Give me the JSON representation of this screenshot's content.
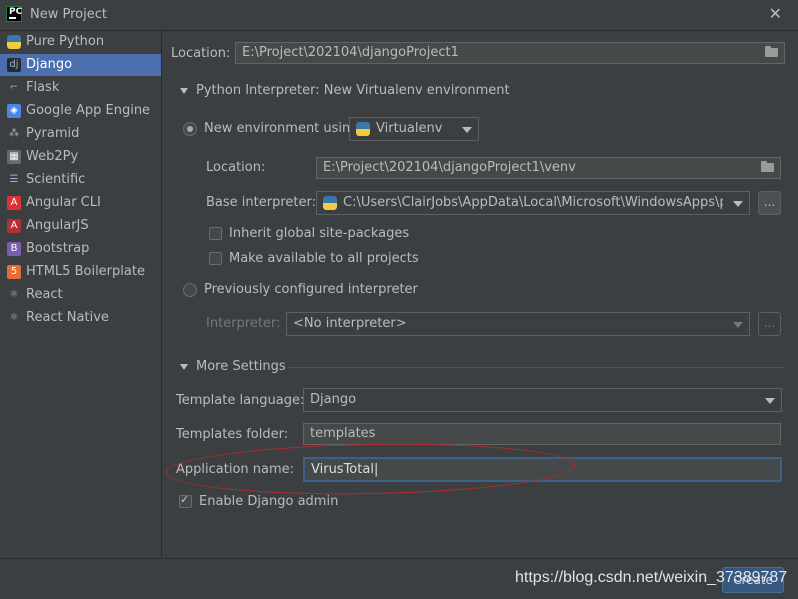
{
  "window": {
    "app_icon": "PC",
    "title": "New Project",
    "close_icon": "close-icon"
  },
  "sidebar": {
    "items": [
      {
        "label": "Pure Python",
        "icon": "python-icon",
        "icon_text": "",
        "color": "#3b77a8",
        "selected": false
      },
      {
        "label": "Django",
        "icon": "django-icon",
        "icon_text": "dj",
        "color": "#2b2b2b",
        "selected": true
      },
      {
        "label": "Flask",
        "icon": "flask-icon",
        "icon_text": "⌐",
        "color": "#3c3f41",
        "selected": false
      },
      {
        "label": "Google App Engine",
        "icon": "google-app-engine-icon",
        "icon_text": "◈",
        "color": "#4a86e8",
        "selected": false
      },
      {
        "label": "Pyramid",
        "icon": "pyramid-icon",
        "icon_text": "⁂",
        "color": "#3c3f41",
        "selected": false
      },
      {
        "label": "Web2Py",
        "icon": "web2py-icon",
        "icon_text": "▦",
        "color": "#6a6a6a",
        "selected": false
      },
      {
        "label": "Scientific",
        "icon": "scientific-icon",
        "icon_text": "☰",
        "color": "#3c3f41",
        "selected": false
      },
      {
        "label": "Angular CLI",
        "icon": "angular-cli-icon",
        "icon_text": "A",
        "color": "#dd3333",
        "selected": false
      },
      {
        "label": "AngularJS",
        "icon": "angularjs-icon",
        "icon_text": "A",
        "color": "#b52e31",
        "selected": false
      },
      {
        "label": "Bootstrap",
        "icon": "bootstrap-icon",
        "icon_text": "B",
        "color": "#7b5bb3",
        "selected": false
      },
      {
        "label": "HTML5 Boilerplate",
        "icon": "html5-icon",
        "icon_text": "5",
        "color": "#e36f36",
        "selected": false
      },
      {
        "label": "React",
        "icon": "react-icon",
        "icon_text": "⚛",
        "color": "#3c3f41",
        "selected": false
      },
      {
        "label": "React Native",
        "icon": "react-native-icon",
        "icon_text": "⚛",
        "color": "#3c3f41",
        "selected": false
      }
    ]
  },
  "main": {
    "location_label": "Location:",
    "location_value": "E:\\Project\\202104\\djangoProject1",
    "interpreter_section": "Python Interpreter: New Virtualenv environment",
    "new_env_label": "New environment using",
    "new_env_tool": "Virtualenv",
    "venv_location_label": "Location:",
    "venv_location_value": "E:\\Project\\202104\\djangoProject1\\venv",
    "base_interpreter_label": "Base interpreter:",
    "base_interpreter_value": "C:\\Users\\ClairJobs\\AppData\\Local\\Microsoft\\WindowsApps\\python",
    "dots": "...",
    "inherit_label": "Inherit global site-packages",
    "available_label": "Make available to all projects",
    "prev_interp_label": "Previously configured interpreter",
    "interpreter_label": "Interpreter:",
    "interpreter_value": "<No interpreter>",
    "more_settings": "More Settings",
    "template_lang_label": "Template language:",
    "template_lang_value": "Django",
    "templates_folder_label": "Templates folder:",
    "templates_folder_value": "templates",
    "app_name_label": "Application name:",
    "app_name_value": "VirusTotal",
    "enable_admin_label": "Enable Django admin"
  },
  "footer": {
    "create_label": "Create",
    "watermark": "https://blog.csdn.net/weixin_37389787"
  },
  "colors": {
    "selected": "#4b6eaf",
    "annotation": "#b52a2a"
  }
}
